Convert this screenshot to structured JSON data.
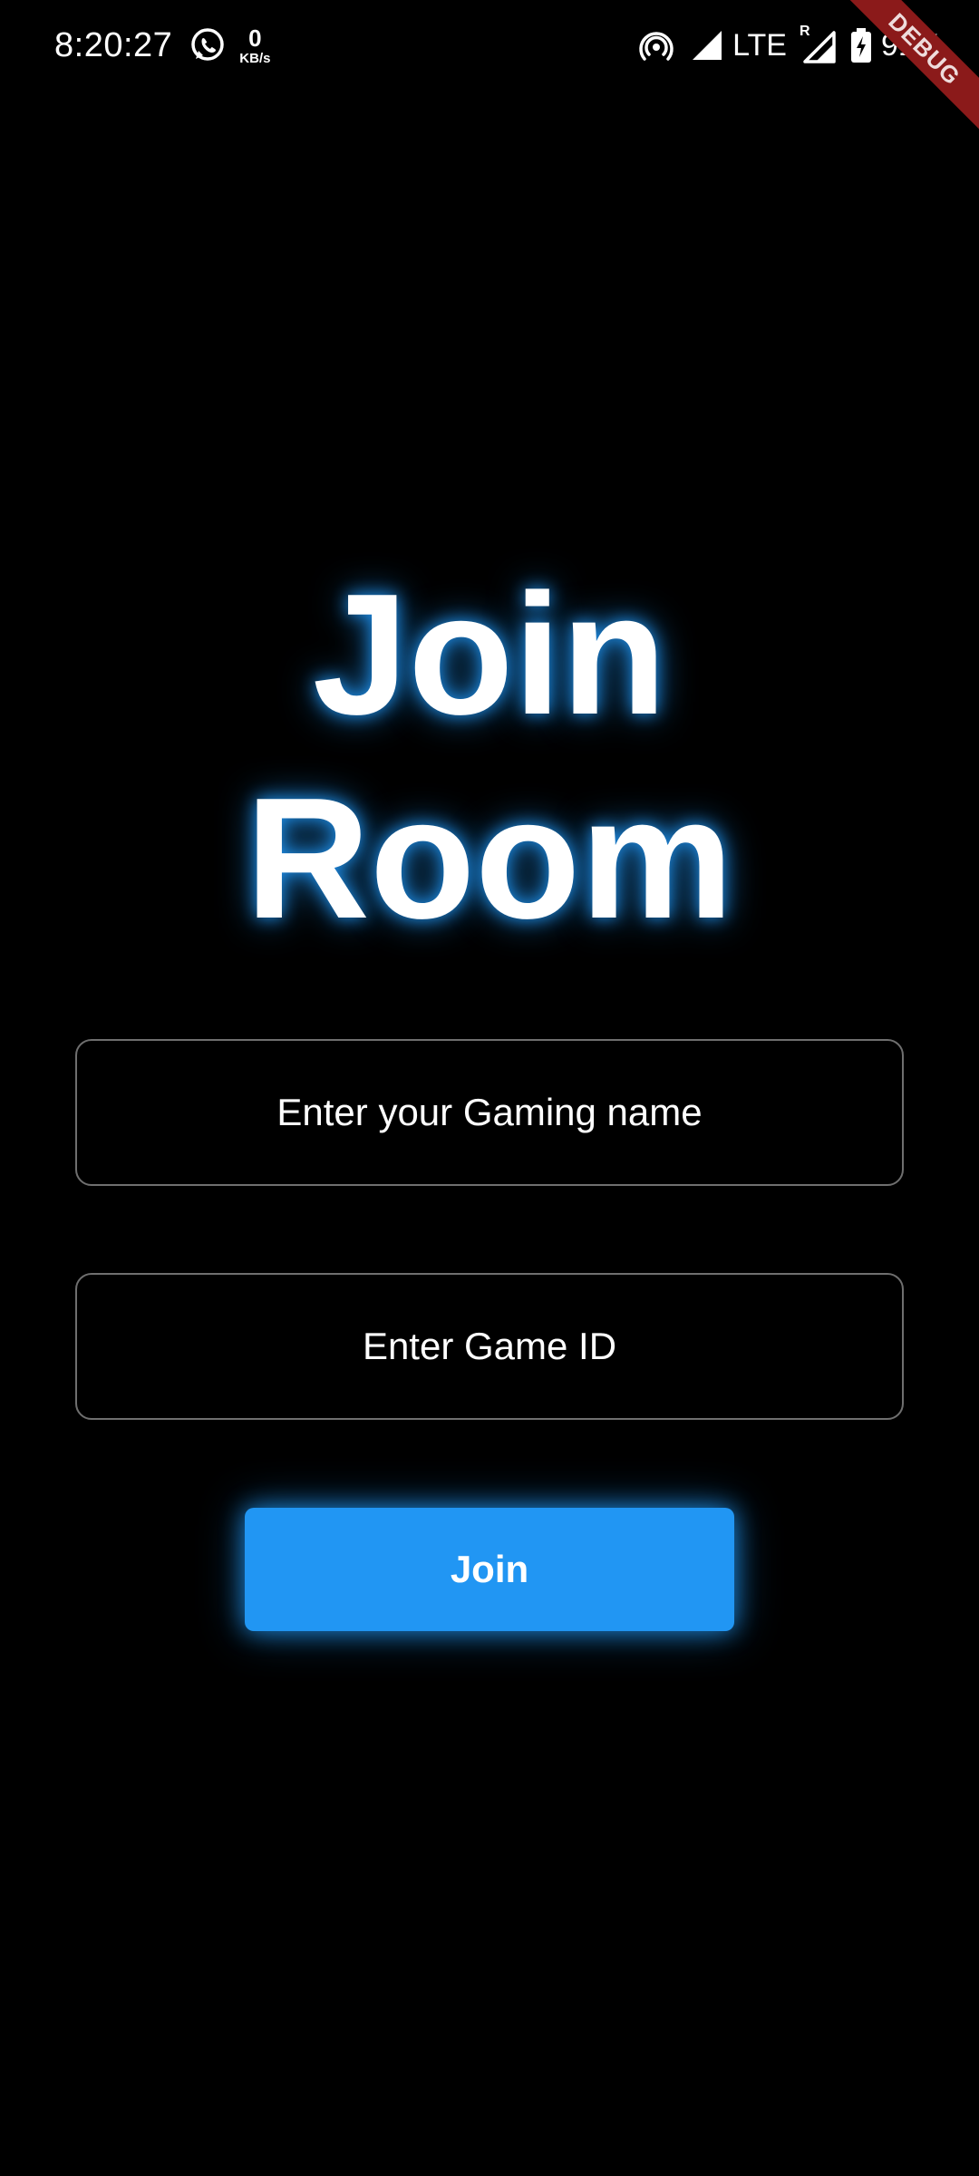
{
  "status_bar": {
    "time": "8:20:27",
    "net_speed_value": "0",
    "net_speed_unit": "KB/s",
    "network_type": "LTE",
    "roaming_label": "R",
    "battery_percent": "91%",
    "icons": [
      "whatsapp-icon",
      "hotspot-icon",
      "signal-icon",
      "roaming-signal-icon",
      "battery-charging-icon"
    ]
  },
  "debug_banner": {
    "label": "DEBUG",
    "color": "#8b1a1a"
  },
  "title": {
    "line1": "Join",
    "line2": "Room",
    "glow_color": "#2196f3"
  },
  "form": {
    "name_placeholder": "Enter your Gaming name",
    "game_id_placeholder": "Enter Game ID",
    "join_label": "Join",
    "accent_color": "#2196f3"
  }
}
